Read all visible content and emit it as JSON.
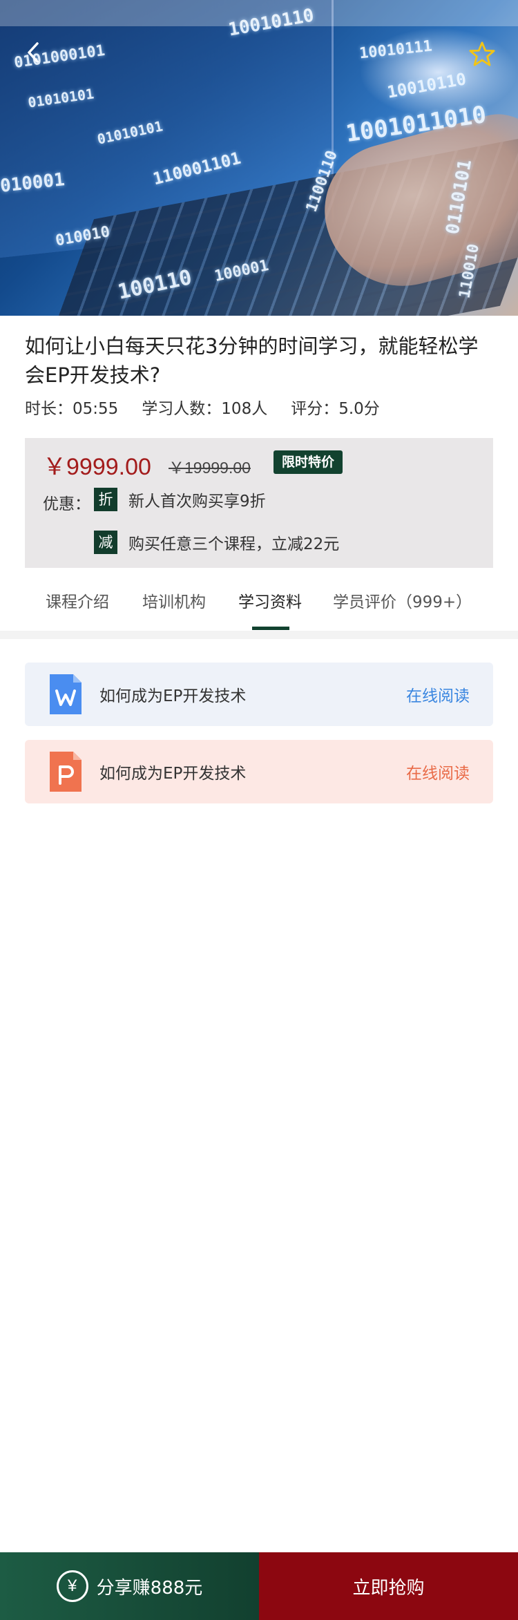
{
  "hero": {
    "binary_lines": [
      "0101000101",
      "10010110",
      "01010101",
      "110001101",
      "010001",
      "1001011010",
      "10010110",
      "100110",
      "0110101",
      "1100110",
      "010010",
      "100001",
      "10010111",
      "01010101",
      "110010"
    ],
    "back_icon": "chevron-left-icon",
    "favorite_icon": "star-outline-icon"
  },
  "course": {
    "title": "如何让小白每天只花3分钟的时间学习，就能轻松学会EP开发技术?",
    "meta": {
      "duration": "时长：05:55",
      "learners": "学习人数：108人",
      "rating": "评分：5.0分"
    }
  },
  "pricing": {
    "current": "￥9999.00",
    "original": "￥19999.00",
    "tag": "限时特价",
    "promo_label": "优惠：",
    "promos": [
      {
        "badge": "折",
        "text": "新人首次购买享9折"
      },
      {
        "badge": "减",
        "text": "购买任意三个课程，立减22元"
      }
    ]
  },
  "tabs": [
    {
      "label": "课程介绍",
      "active": false
    },
    {
      "label": "培训机构",
      "active": false
    },
    {
      "label": "学习资料",
      "active": true
    },
    {
      "label": "学员评价（999+）",
      "active": false
    }
  ],
  "documents": [
    {
      "icon": "word-doc-icon",
      "name": "如何成为EP开发技术",
      "action": "在线阅读",
      "color": "#3a86e0"
    },
    {
      "icon": "ppt-doc-icon",
      "name": "如何成为EP开发技术",
      "action": "在线阅读",
      "color": "#e96b48"
    }
  ],
  "bottom_bar": {
    "share_icon": "yen-circle-icon",
    "share_label": "分享赚888元",
    "buy_label": "立即抢购",
    "share_color": "#1d5c44",
    "buy_color": "#8c0710"
  }
}
